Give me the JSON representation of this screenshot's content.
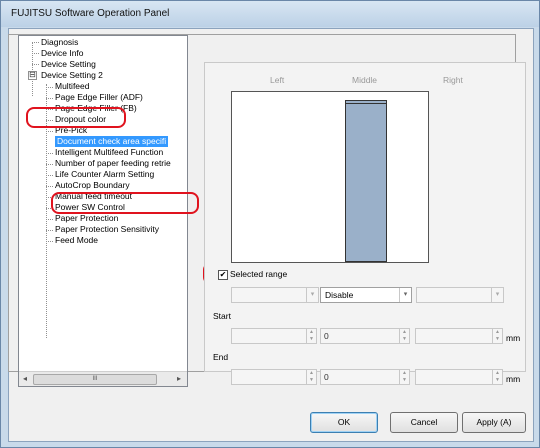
{
  "window": {
    "title": "FUJITSU Software Operation Panel"
  },
  "tree": {
    "items": [
      {
        "label": "Diagnosis"
      },
      {
        "label": "Device Info"
      },
      {
        "label": "Device Setting"
      },
      {
        "label": "Device Setting 2",
        "expander": "⊟"
      },
      {
        "label": "Multifeed"
      },
      {
        "label": "Page Edge Filler (ADF)"
      },
      {
        "label": "Page Edge Filler (FB)"
      },
      {
        "label": "Dropout color"
      },
      {
        "label": "Pre-Pick"
      },
      {
        "label": "Document check area specifi"
      },
      {
        "label": "Intelligent Multifeed Function"
      },
      {
        "label": "Number of paper feeding retrie"
      },
      {
        "label": "Life Counter Alarm Setting"
      },
      {
        "label": "AutoCrop Boundary"
      },
      {
        "label": "Manual feed timeout"
      },
      {
        "label": "Power SW Control"
      },
      {
        "label": "Paper Protection"
      },
      {
        "label": "Paper Protection Sensitivity"
      },
      {
        "label": "Feed Mode"
      }
    ],
    "scroll_left": "◂",
    "scroll_thumb": "III",
    "scroll_right": "▸"
  },
  "columns": {
    "left": "Left",
    "middle": "Middle",
    "right": "Right"
  },
  "selected_range": {
    "label": "Selected range",
    "check": "✔"
  },
  "mode_row": {
    "left": "",
    "middle": "Disable",
    "right": ""
  },
  "start": {
    "label": "Start",
    "left": "",
    "middle": "0",
    "right": "",
    "unit": "mm"
  },
  "end": {
    "label": "End",
    "left": "",
    "middle": "0",
    "right": "",
    "unit": "mm"
  },
  "buttons": {
    "ok": "OK",
    "cancel": "Cancel",
    "apply": "Apply (A)"
  },
  "icons": {
    "dropdown": "▾",
    "spin_up": "▲",
    "spin_down": "▼"
  }
}
